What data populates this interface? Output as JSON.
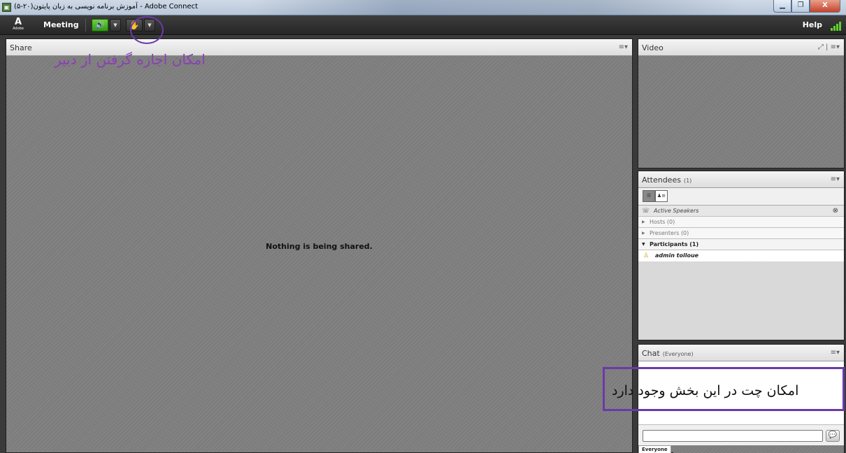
{
  "window": {
    "title": "آموزش برنامه نویسی به زبان پایتون(۲۰-۵) - Adobe Connect",
    "min_glyph": "▁",
    "max_glyph": "❐",
    "close_glyph": "X"
  },
  "appbar": {
    "logo_letter": "A",
    "logo_word": "Adobe",
    "meeting_menu": "Meeting",
    "speaker_glyph": "🔊",
    "dropdown_glyph": "▼",
    "mic_glyph": "✋",
    "help_menu": "Help"
  },
  "share": {
    "title": "Share",
    "menu_glyph": "≡▾",
    "empty_message": "Nothing is being shared."
  },
  "video": {
    "title": "Video",
    "menu_glyph": "⤢ | ≡▾"
  },
  "attendees": {
    "title": "Attendees",
    "count": "(1)",
    "menu_glyph": "≡▾",
    "active_speakers": "Active Speakers",
    "close_glyph": "⊗",
    "groups": [
      {
        "label": "Hosts (0)",
        "arrow": "▶"
      },
      {
        "label": "Presenters (0)",
        "arrow": "▶"
      },
      {
        "label": "Participants (1)",
        "arrow": "▼"
      }
    ],
    "user": "admin tolloue"
  },
  "chat": {
    "title": "Chat",
    "scope": "(Everyone)",
    "menu_glyph": "≡▾",
    "send_glyph": "💬",
    "tab": "Everyone"
  },
  "annotations": {
    "raise_hand": "امکان اجازه گرفتن از دبیر",
    "chat_note": "امکان چت در این بخش وجود دارد"
  },
  "colors": {
    "accent_annotation": "#6b3aa8",
    "speaker_green": "#4fbf24",
    "signal_green": "#5fd12a"
  }
}
